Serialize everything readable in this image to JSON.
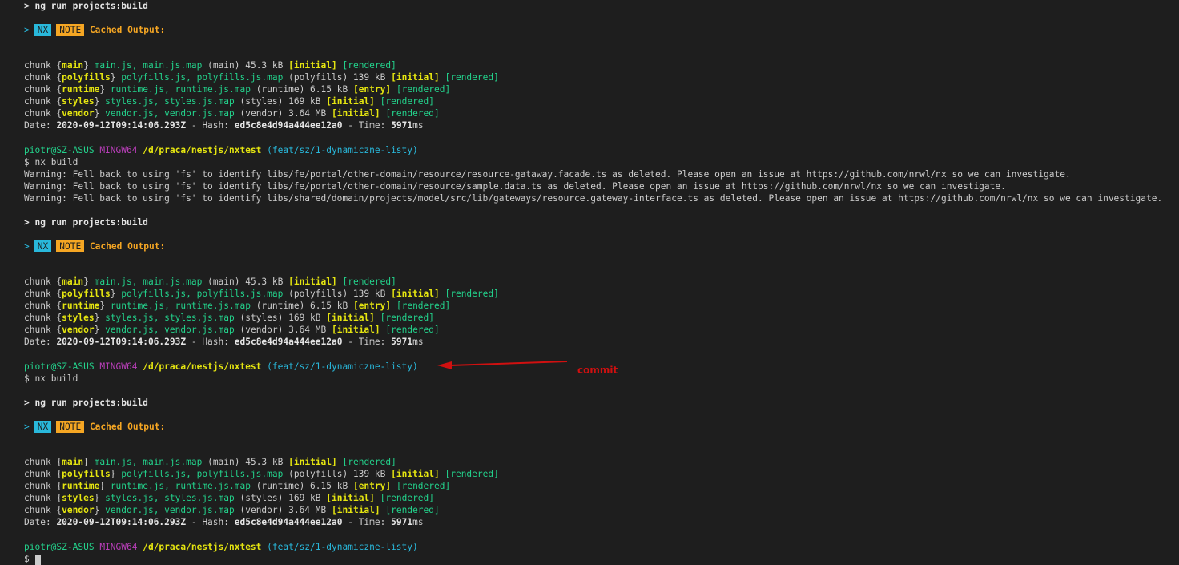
{
  "terminal": {
    "prompt": {
      "user": "piotr@SZ-ASUS",
      "shell": "MINGW64",
      "path": "/d/praca/nestjs/nxtest",
      "branch": "(feat/sz/1-dynamiczne-listy)",
      "dollar": "$",
      "command": "nx build"
    },
    "ng_run": "> ng run projects:build",
    "nx_chevron": ">",
    "nx_badge": "NX",
    "note_badge": "NOTE",
    "cached_output": "Cached Output:",
    "chunks": [
      {
        "prefix": "chunk {",
        "name": "main",
        "close": "}",
        "files": "main.js, main.js.map",
        "label": "(main) 45.3 kB",
        "flag": "[initial]",
        "rendered": "[rendered]"
      },
      {
        "prefix": "chunk {",
        "name": "polyfills",
        "close": "}",
        "files": "polyfills.js, polyfills.js.map",
        "label": "(polyfills) 139 kB",
        "flag": "[initial]",
        "rendered": "[rendered]"
      },
      {
        "prefix": "chunk {",
        "name": "runtime",
        "close": "}",
        "files": "runtime.js, runtime.js.map",
        "label": "(runtime) 6.15 kB",
        "flag": "[entry]",
        "rendered": "[rendered]"
      },
      {
        "prefix": "chunk {",
        "name": "styles",
        "close": "}",
        "files": "styles.js, styles.js.map",
        "label": "(styles) 169 kB",
        "flag": "[initial]",
        "rendered": "[rendered]"
      },
      {
        "prefix": "chunk {",
        "name": "vendor",
        "close": "}",
        "files": "vendor.js, vendor.js.map",
        "label": "(vendor) 3.64 MB",
        "flag": "[initial]",
        "rendered": "[rendered]"
      }
    ],
    "date_label": "Date:",
    "date_value": "2020-09-12T09:14:06.293Z",
    "hash_label": "- Hash:",
    "hash_value": "ed5c8e4d94a444ee12a0",
    "time_label": "- Time:",
    "time_value": "5971",
    "time_unit": "ms",
    "warnings": [
      "Warning: Fell back to using 'fs' to identify libs/fe/portal/other-domain/resource/resource-gataway.facade.ts as deleted. Please open an issue at https://github.com/nrwl/nx so we can investigate.",
      "Warning: Fell back to using 'fs' to identify libs/fe/portal/other-domain/resource/sample.data.ts as deleted. Please open an issue at https://github.com/nrwl/nx so we can investigate.",
      "Warning: Fell back to using 'fs' to identify libs/shared/domain/projects/model/src/lib/gateways/resource.gateway-interface.ts as deleted. Please open an issue at https://github.com/nrwl/nx so we can investigate."
    ]
  },
  "annotation": {
    "label": "commit",
    "color": "#d01010"
  },
  "colors": {
    "background": "#1e1e1e",
    "green": "#23d18b",
    "cyan": "#29b8db",
    "yellow": "#e5e510",
    "magenta": "#bc3fbc",
    "orange": "#f5a623",
    "red": "#d01010"
  }
}
